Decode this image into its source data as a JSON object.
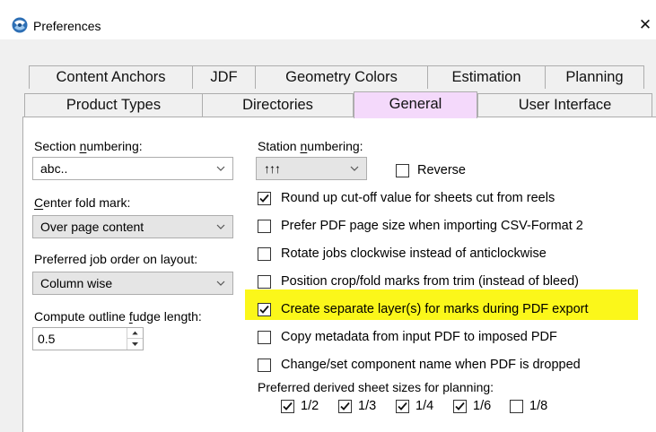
{
  "window": {
    "title": "Preferences",
    "close_glyph": "✕"
  },
  "tabs_row1": [
    "Content Anchors",
    "JDF",
    "Geometry Colors",
    "Estimation",
    "Planning"
  ],
  "tabs_row2": [
    "Product Types",
    "Directories",
    "General",
    "User Interface"
  ],
  "selected_tab": "General",
  "left": {
    "section_numbering": {
      "label_pre": "Section ",
      "label_ul": "n",
      "label_post": "umbering:",
      "value": "abc.."
    },
    "center_fold": {
      "label_pre": "",
      "label_ul": "C",
      "label_post": "enter fold mark:",
      "value": "Over page content"
    },
    "job_order": {
      "label": "Preferred job order on layout:",
      "value": "Column wise"
    },
    "fudge": {
      "label_pre": "Compute outline ",
      "label_ul": "f",
      "label_post": "udge length:",
      "value": "0.5"
    }
  },
  "right": {
    "station_numbering": {
      "label_pre": "Station ",
      "label_ul": "n",
      "label_post": "umbering:",
      "value": "↑↑↑"
    },
    "reverse": {
      "label": "Reverse",
      "checked": false
    },
    "options": [
      {
        "label": "Round up cut-off value for sheets cut from reels",
        "checked": true
      },
      {
        "label": "Prefer PDF page size when importing CSV-Format 2",
        "checked": false
      },
      {
        "label": "Rotate jobs clockwise instead of anticlockwise",
        "checked": false
      },
      {
        "label": "Position crop/fold marks from trim (instead of bleed)",
        "checked": false
      },
      {
        "label": "Create separate layer(s) for marks during PDF export",
        "checked": true
      },
      {
        "label": "Copy metadata from input PDF to imposed PDF",
        "checked": false
      },
      {
        "label": "Change/set component name when PDF is dropped",
        "checked": false
      }
    ],
    "derived_sizes": {
      "label": "Preferred derived sheet sizes for planning:",
      "items": [
        {
          "label": "1/2",
          "checked": true
        },
        {
          "label": "1/3",
          "checked": true
        },
        {
          "label": "1/4",
          "checked": true
        },
        {
          "label": "1/6",
          "checked": true
        },
        {
          "label": "1/8",
          "checked": false
        }
      ]
    }
  },
  "colors": {
    "selected_tab": "#f4d9fb",
    "highlight": "#fbf71a",
    "app_icon": "#2d6fb5"
  },
  "icons": [
    "app-icon",
    "close-icon",
    "chevron-down-icon",
    "spin-up-icon",
    "spin-down-icon",
    "checkmark-icon"
  ]
}
